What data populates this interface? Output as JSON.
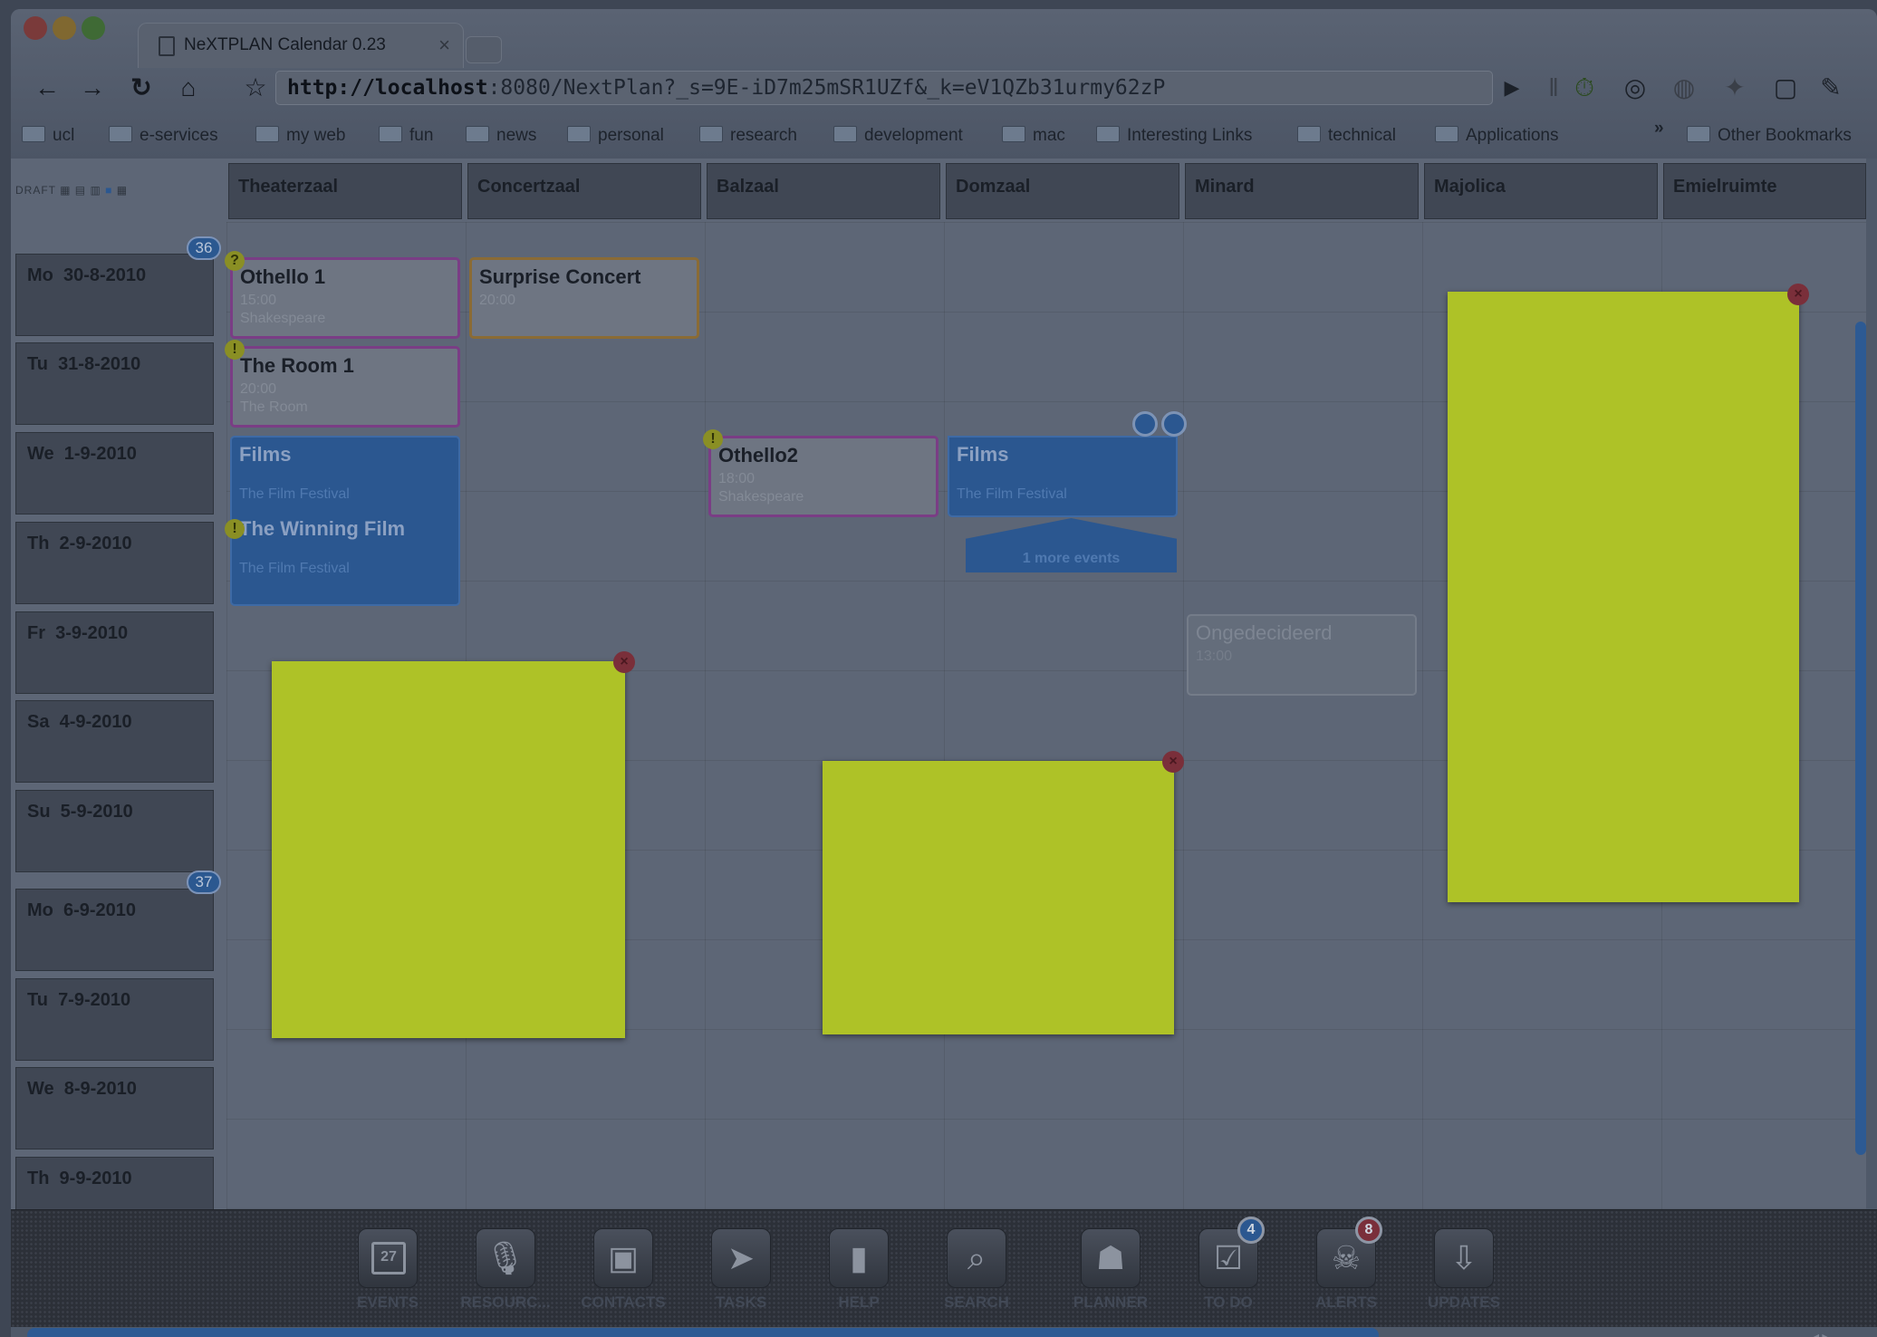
{
  "browser": {
    "tab_title": "NeXTPLAN Calendar 0.23",
    "tab_close": "×",
    "url_host": "http://localhost",
    "url_rest": ":8080/NextPlan?_s=9E-iD7m25mSR1UZf&_k=eV1QZb31urmy62zP",
    "bookmarks": [
      "ucl",
      "e-services",
      "my web",
      "fun",
      "news",
      "personal",
      "research",
      "development",
      "mac",
      "Interesting Links",
      "technical",
      "Applications"
    ],
    "bookmarks_more": "»",
    "other_bookmarks": "Other Bookmarks"
  },
  "view_modes": "DRAFT",
  "rooms": [
    "Theaterzaal",
    "Concertzaal",
    "Balzaal",
    "Domzaal",
    "Minard",
    "Majolica",
    "Emielruimte"
  ],
  "days": [
    {
      "label": "Mo  30-8-2010",
      "week": "36"
    },
    {
      "label": "Tu  31-8-2010"
    },
    {
      "label": "We  1-9-2010"
    },
    {
      "label": "Th  2-9-2010"
    },
    {
      "label": "Fr  3-9-2010"
    },
    {
      "label": "Sa  4-9-2010"
    },
    {
      "label": "Su  5-9-2010"
    },
    {
      "label": "Mo  6-9-2010",
      "week": "37"
    },
    {
      "label": "Tu  7-9-2010"
    },
    {
      "label": "We  8-9-2010"
    },
    {
      "label": "Th  9-9-2010"
    }
  ],
  "events": {
    "othello1": {
      "title": "Othello 1",
      "time": "15:00",
      "sub": "Shakespeare",
      "flag": "?"
    },
    "surprise": {
      "title": "Surprise Concert",
      "time": "20:00"
    },
    "room1": {
      "title": "The Room 1",
      "time": "20:00",
      "sub": "The Room",
      "flag": "!"
    },
    "films1": {
      "title": "Films",
      "sub": "The Film Festival"
    },
    "winning": {
      "title": "The Winning Film",
      "sub": "The Film Festival",
      "flag": "!",
      "count": "2"
    },
    "othello2": {
      "title": "Othello2",
      "time": "18:00",
      "sub": "Shakespeare",
      "flag": "!"
    },
    "films2": {
      "title": "Films",
      "sub": "The Film Festival"
    },
    "more": "1 more events",
    "ongedecideerd": {
      "title": "Ongedecideerd",
      "time": "13:00"
    }
  },
  "note_close": "×",
  "dock": [
    {
      "label": "EVENTS",
      "icon": "calendar-icon",
      "day": "27"
    },
    {
      "label": "RESOURC...",
      "icon": "microphone-icon"
    },
    {
      "label": "CONTACTS",
      "icon": "contact-card-icon"
    },
    {
      "label": "TASKS",
      "icon": "paper-plane-icon"
    },
    {
      "label": "HELP",
      "icon": "bookmark-icon"
    },
    {
      "label": "SEARCH",
      "icon": "magnifier-icon"
    },
    {
      "label": "PLANNER",
      "icon": "person-icon"
    },
    {
      "label": "TO DO",
      "icon": "checkbox-icon",
      "badge": "4"
    },
    {
      "label": "ALERTS",
      "icon": "skull-icon",
      "badge": "8"
    },
    {
      "label": "UPDATES",
      "icon": "download-tray-icon"
    }
  ],
  "colors": {
    "accent": "#2b5790",
    "note": "#aec227",
    "overlay": "#4f5969"
  }
}
